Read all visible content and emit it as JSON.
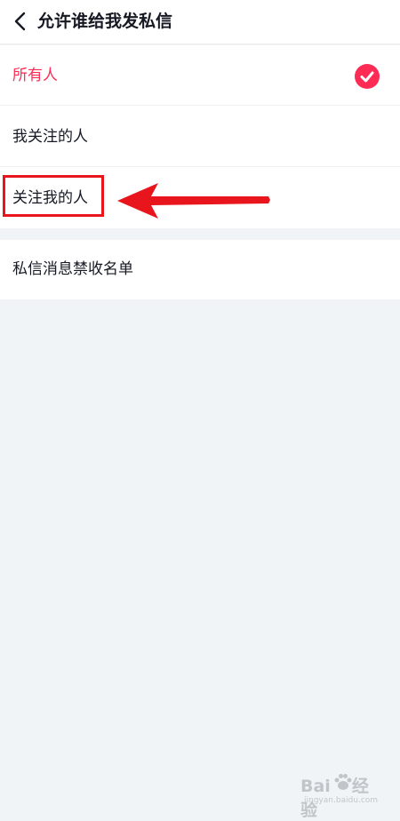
{
  "header": {
    "title": "允许谁给我发私信",
    "back_icon": "chevron-left-icon"
  },
  "options": [
    {
      "label": "所有人",
      "selected": true
    },
    {
      "label": "我关注的人",
      "selected": false
    },
    {
      "label": "关注我的人",
      "selected": false
    }
  ],
  "blocklist": {
    "label": "私信消息禁收名单"
  },
  "annotation": {
    "highlight_color": "#e8151d",
    "arrow_color": "#e8151d"
  },
  "watermark": {
    "logo_text": "Bai",
    "logo_suffix": "经验",
    "url": "jingyan.baidu.com"
  },
  "colors": {
    "accent": "#fe2c55",
    "text": "#161823",
    "background": "#f1f4f7"
  }
}
